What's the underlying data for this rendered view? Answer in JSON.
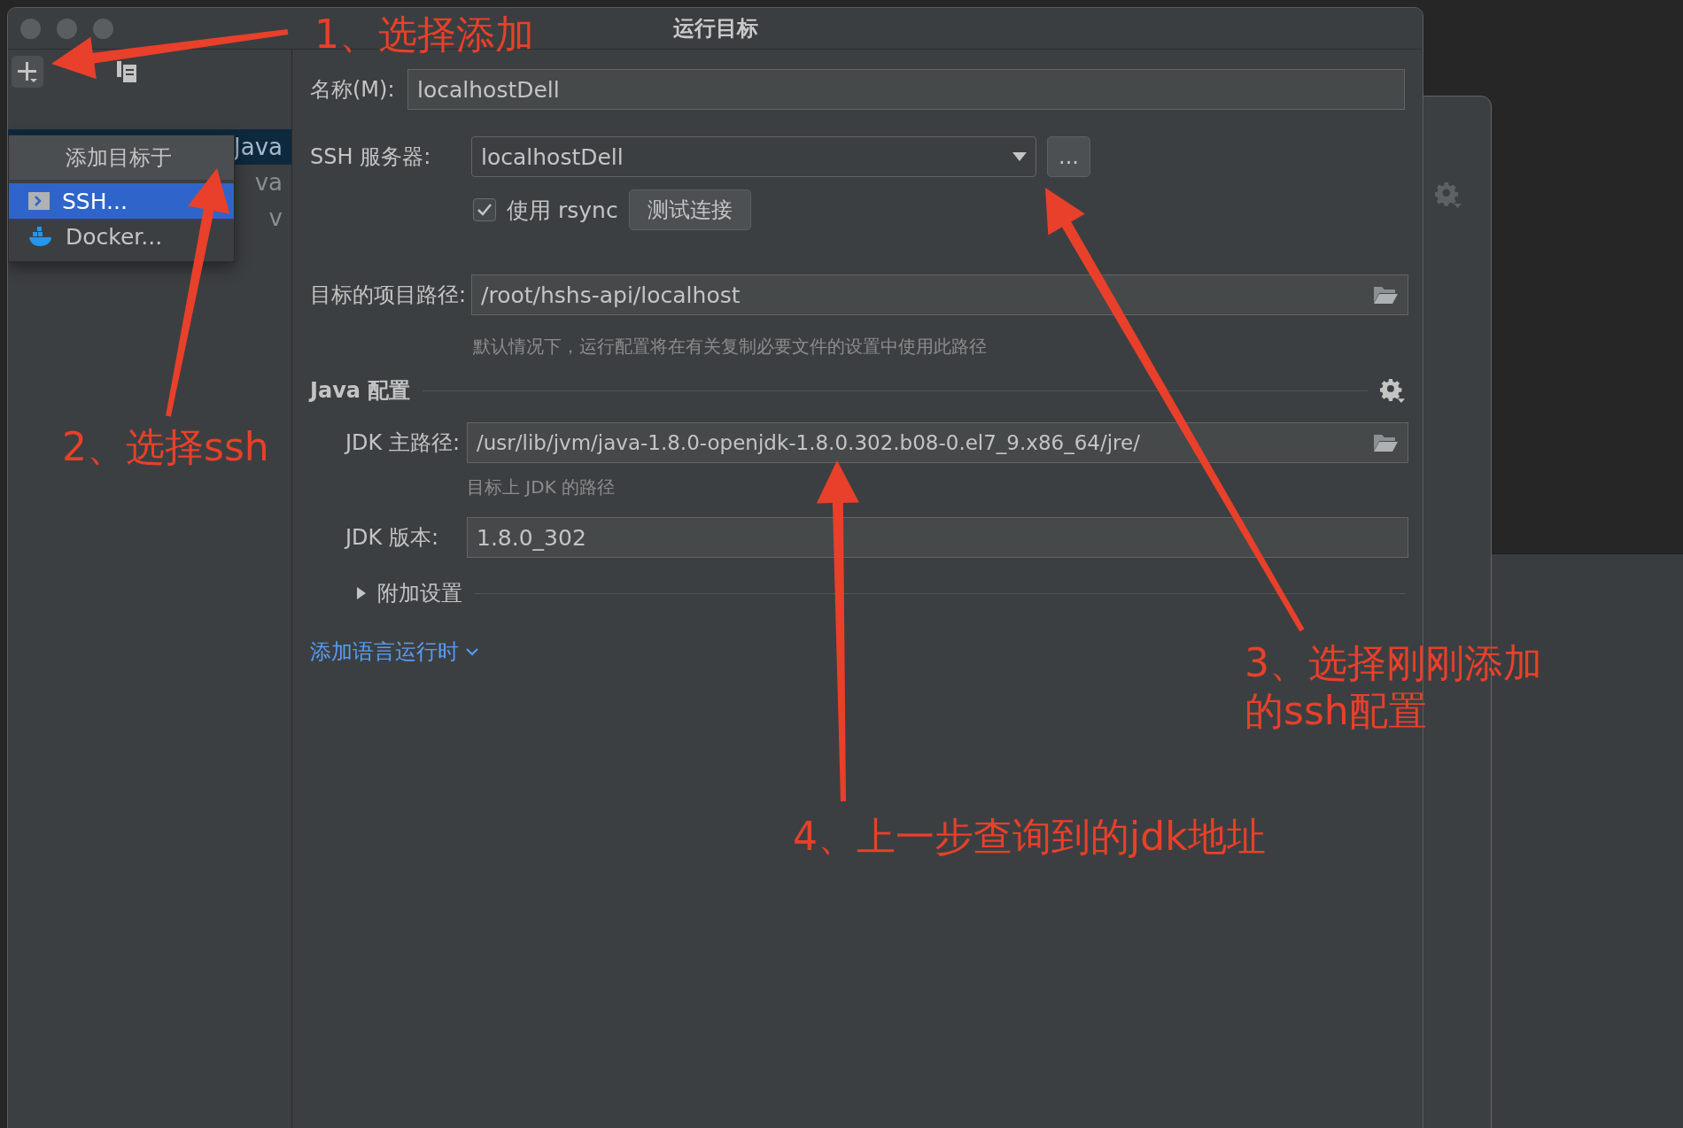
{
  "window": {
    "title": "运行目标"
  },
  "add_menu": {
    "header": "添加目标于",
    "items": [
      {
        "label": "SSH...",
        "kind": "ssh",
        "selected": true
      },
      {
        "label": "Docker...",
        "kind": "docker",
        "selected": false
      }
    ]
  },
  "target_list": [
    {
      "label": "Java",
      "selected": true
    },
    {
      "label": "va",
      "selected": false
    },
    {
      "label": "v",
      "selected": false
    }
  ],
  "form": {
    "name": {
      "label": "名称(M):",
      "value": "localhostDell"
    },
    "ssh_server": {
      "label": "SSH 服务器:",
      "value": "localhostDell",
      "more": "..."
    },
    "rsync": {
      "label": "使用 rsync",
      "checked": true
    },
    "test_button": "测试连接",
    "project_path": {
      "label": "目标的项目路径:",
      "value": "/root/hshs-api/localhost",
      "hint": "默认情况下，运行配置将在有关复制必要文件的设置中使用此路径"
    },
    "java_section": {
      "title": "Java 配置",
      "jdk_home": {
        "label": "JDK 主路径:",
        "value": "/usr/lib/jvm/java-1.8.0-openjdk-1.8.0.302.b08-0.el7_9.x86_64/jre/",
        "hint": "目标上 JDK 的路径"
      },
      "jdk_version": {
        "label": "JDK 版本:",
        "value": "1.8.0_302"
      }
    },
    "additional_settings": {
      "label": "附加设置",
      "expanded": false
    },
    "add_runtime_link": "添加语言运行时"
  },
  "annotations": [
    {
      "lines": [
        "1、选择添加"
      ]
    },
    {
      "lines": [
        "2、选择ssh"
      ]
    },
    {
      "lines": [
        "3、选择刚刚添加",
        "的ssh配置"
      ]
    },
    {
      "lines": [
        "4、上一步查询到的jdk地址"
      ]
    }
  ]
}
